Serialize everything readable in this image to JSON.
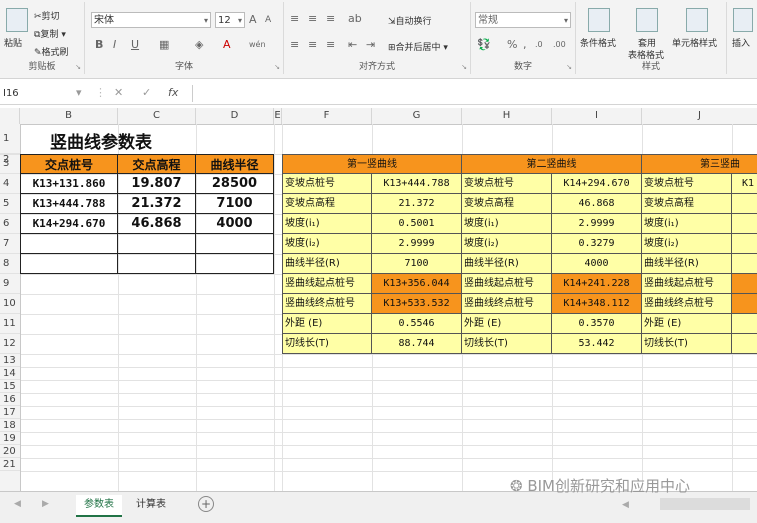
{
  "ribbon": {
    "clipboard": {
      "paste": "粘贴",
      "cut": "剪切",
      "copy": "复制",
      "format_painter": "格式刷",
      "label": "剪贴板"
    },
    "font": {
      "name": "宋体",
      "size": "12",
      "label": "字体",
      "bold": "B",
      "italic": "I",
      "underline": "U",
      "grow": "A",
      "shrink": "A",
      "font_color": "A",
      "phonetic": "wén"
    },
    "alignment": {
      "wrap": "自动换行",
      "merge": "合并后居中",
      "label": "对齐方式"
    },
    "number": {
      "format": "常规",
      "percent": "%",
      "comma": ",",
      "label": "数字"
    },
    "styles": {
      "conditional": "条件格式",
      "table_format_1": "套用",
      "table_format_2": "表格格式",
      "cell_styles": "单元格样式",
      "label": "样式"
    },
    "cells": {
      "insert": "插入"
    }
  },
  "formula_bar": {
    "name_box": "I16",
    "fx": "fx",
    "formula": ""
  },
  "columns": [
    "B",
    "C",
    "D",
    "E",
    "F",
    "G",
    "H",
    "I",
    "J"
  ],
  "rows": [
    "1",
    "2",
    "3",
    "4",
    "5",
    "6",
    "7",
    "8",
    "9",
    "10",
    "11",
    "12",
    "13",
    "14",
    "15",
    "16",
    "17",
    "18",
    "19",
    "20",
    "21"
  ],
  "sheet": {
    "title": "竖曲线参数表",
    "table1": {
      "headers": [
        "交点桩号",
        "交点高程",
        "曲线半径"
      ],
      "rows": [
        [
          "K13+131.860",
          "19.807",
          "28500"
        ],
        [
          "K13+444.788",
          "21.372",
          "7100"
        ],
        [
          "K14+294.670",
          "46.868",
          "4000"
        ]
      ]
    },
    "table2": {
      "curves": [
        "第一竖曲线",
        "第二竖曲线",
        "第三竖曲"
      ],
      "labels": [
        "变坡点桩号",
        "变坡点高程",
        "坡度(i₁)",
        "坡度(i₂)",
        "曲线半径(R)",
        "竖曲线起点桩号",
        "竖曲线终点桩号",
        "外距 (E)",
        "切线长(T)"
      ],
      "c1": [
        "K13+444.788",
        "21.372",
        "0.5001",
        "2.9999",
        "7100",
        "K13+356.044",
        "K13+533.532",
        "0.5546",
        "88.744"
      ],
      "c2": [
        "K14+294.670",
        "46.868",
        "2.9999",
        "0.3279",
        "4000",
        "K14+241.228",
        "K14+348.112",
        "0.3570",
        "53.442"
      ],
      "c3_partial": "K1"
    }
  },
  "tabs": {
    "sheet1": "参数表",
    "sheet2": "计算表",
    "add": "+"
  },
  "watermark": "BIM创新研究和应用中心",
  "colors": {
    "header_orange": "#f7941d",
    "cell_yellow": "#ffffa6",
    "excel_green": "#217346"
  }
}
